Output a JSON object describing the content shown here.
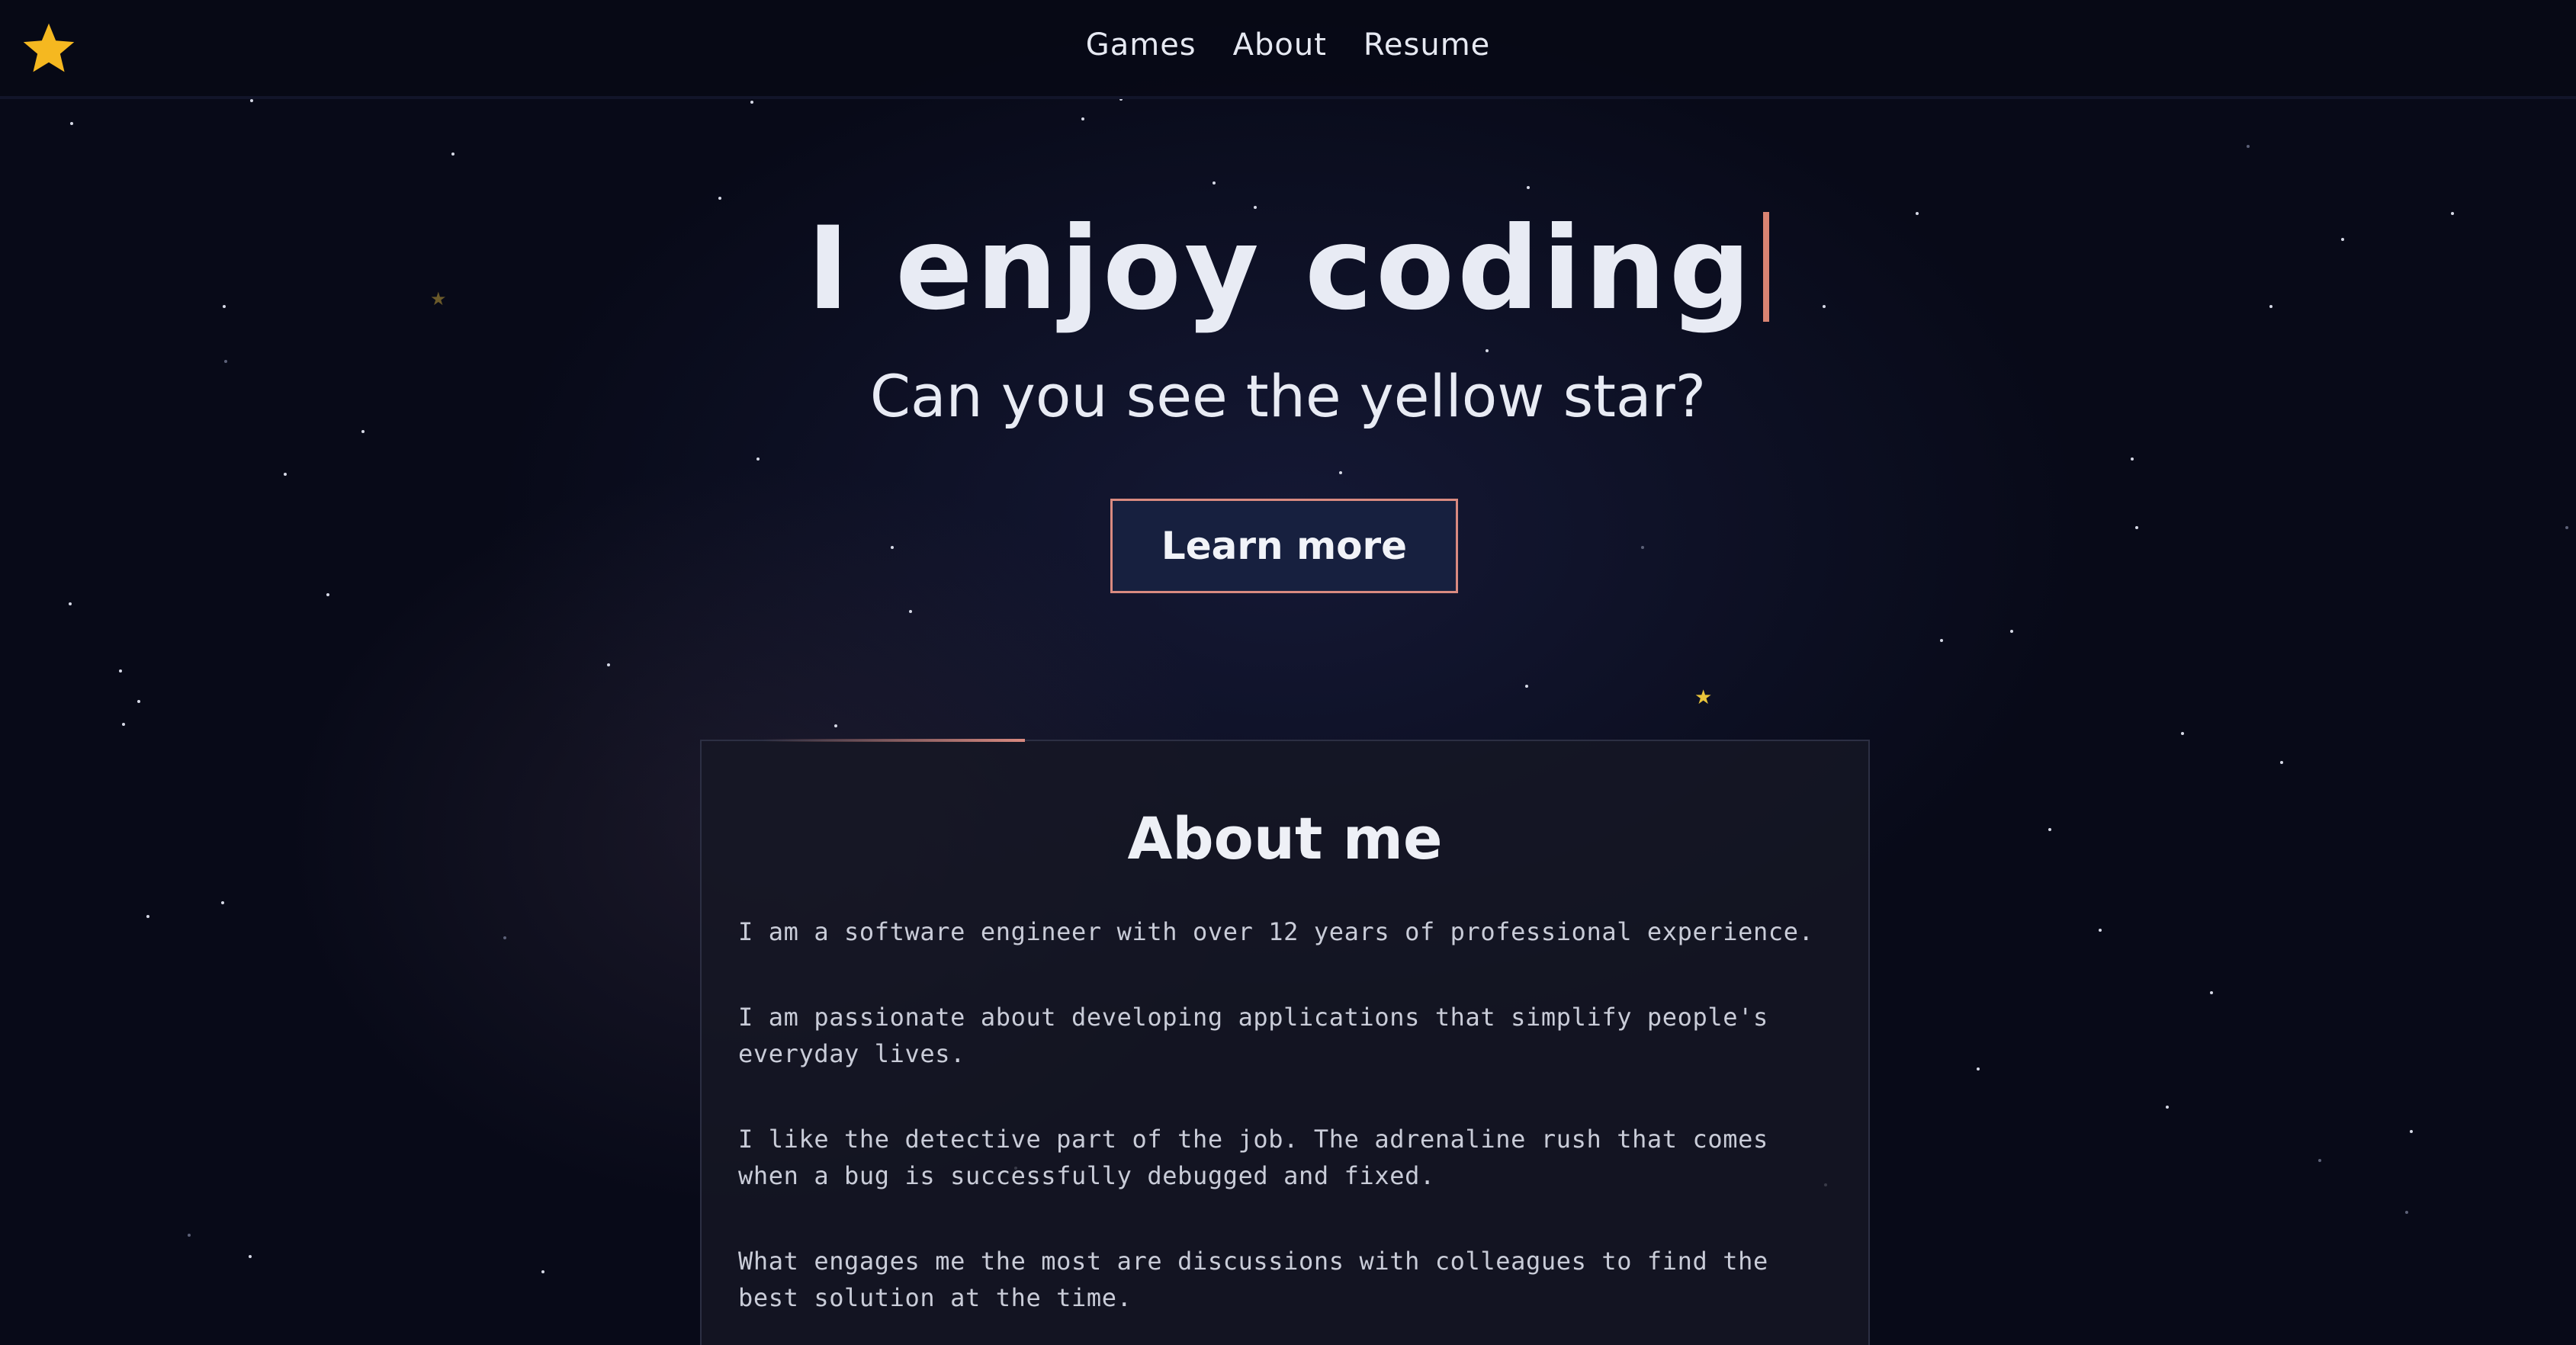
{
  "nav": {
    "logo_icon": "star-icon",
    "logo_color": "#f5b820",
    "links": [
      "Games",
      "About",
      "Resume"
    ]
  },
  "hero": {
    "title": "I enjoy coding",
    "subtitle": "Can you see the yellow star?",
    "button_label": "Learn more",
    "cursor_color": "#d98372"
  },
  "about": {
    "title": "About me",
    "paragraphs": [
      "I am a software engineer with over 12 years of professional experience.",
      "I am passionate about developing applications that simplify people's everyday lives.",
      "I like the detective part of the job. The adrenaline rush that comes when a bug is successfully debugged and fixed.",
      "What engages me the most are discussions with colleagues to find the best solution at the time."
    ]
  },
  "colors": {
    "background": "#080a18",
    "accent": "#d98a80",
    "yellow_star": "#e9c43b"
  }
}
